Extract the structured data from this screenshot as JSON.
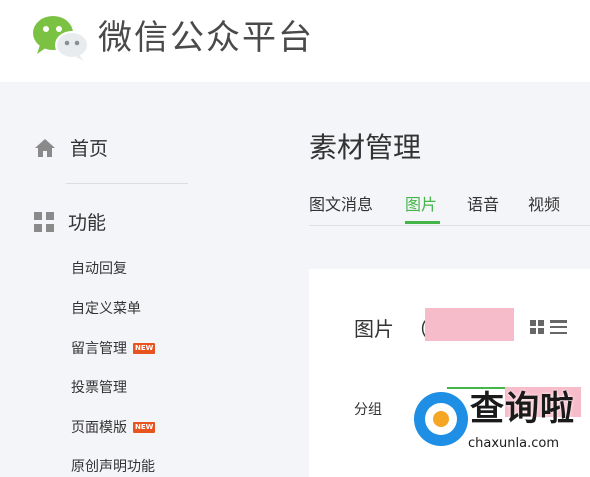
{
  "header": {
    "brand": "微信公众平台"
  },
  "sidebar": {
    "home_label": "首页",
    "function_label": "功能",
    "sub_items": [
      {
        "label": "自动回复",
        "new": false
      },
      {
        "label": "自定义菜单",
        "new": false
      },
      {
        "label": "留言管理",
        "new": true
      },
      {
        "label": "投票管理",
        "new": false
      },
      {
        "label": "页面模版",
        "new": true
      },
      {
        "label": "原创声明功能",
        "new": false
      }
    ],
    "new_badge": "NEW"
  },
  "main": {
    "title": "素材管理",
    "tabs": [
      {
        "label": "图文消息",
        "active": false
      },
      {
        "label": "图片",
        "active": true
      },
      {
        "label": "语音",
        "active": false
      },
      {
        "label": "视频",
        "active": false
      }
    ],
    "card": {
      "title": "图片",
      "paren": "（",
      "group_label": "分组"
    }
  },
  "watermark": {
    "name": "查询啦",
    "url": "chaxunla.com"
  },
  "colors": {
    "accent": "#44b549",
    "badge": "#e8541e",
    "redaction": "#f7bcca",
    "sidebar_bg": "#f4f5f9"
  }
}
